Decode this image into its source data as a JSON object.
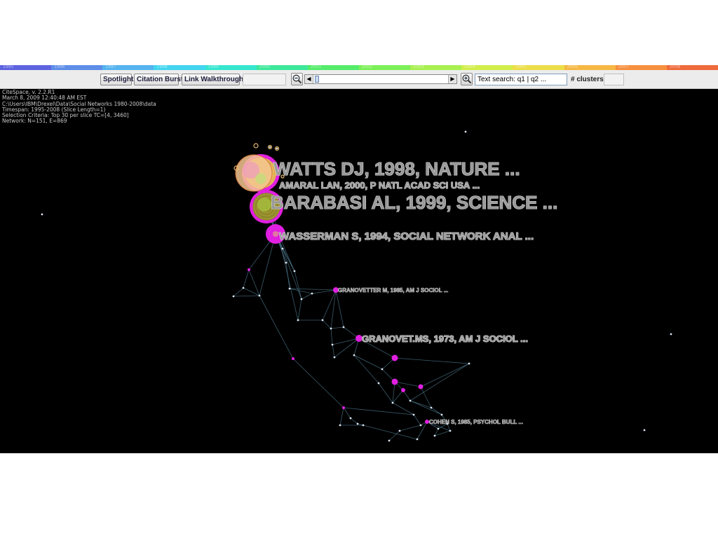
{
  "timeline": {
    "years": [
      "1995",
      "1996",
      "1997",
      "1998",
      "1999",
      "2000",
      "2001",
      "2002",
      "2003",
      "2004",
      "2005",
      "2006",
      "2007",
      "2008"
    ],
    "colors": [
      "#5e64e0",
      "#5e8ee8",
      "#55b3ee",
      "#43d5f0",
      "#36e6cf",
      "#3ee89a",
      "#54ec6a",
      "#7cf058",
      "#a8f050",
      "#d2ee4c",
      "#ecde48",
      "#f6b844",
      "#f69040",
      "#ef6a3c"
    ]
  },
  "toolbar": {
    "spotlight_label": "Spotlight",
    "citation_burst_label": "Citation Burst",
    "link_walkthrough_label": "Link Walkthrough",
    "search_value": "Text search: q1 | q2 ...",
    "clusters_label": "# clusters"
  },
  "info": {
    "version": "CiteSpace, v. 2.2.R1",
    "date": "March 8, 2009 12:40:48 AM EST",
    "path": "C:\\Users\\IBM\\Drexel\\Data\\Social Networks 1980-2008\\data",
    "timespan": "Timespan: 1995-2008 (Slice Length=1)",
    "criteria": "Selection Criteria: Top 30 per slice TC=[4, 3460]",
    "network": "Network: N=151, E=869"
  },
  "labels": [
    {
      "text": "WATTS DJ,  1998,  NATURE ...",
      "size": "xl"
    },
    {
      "text": "AMARAL LAN,  2000,  P NATL ACAD SCI USA ...",
      "size": "m"
    },
    {
      "text": "BARABASI AL,  1999,  SCIENCE ...",
      "size": "xl"
    },
    {
      "text": "WASSERMAN S,  1994,  SOCIAL NETWORK ANAL ...",
      "size": "l"
    },
    {
      "text": "GRANOVETTER M,  1985,  AM J SOCIOL ...",
      "size": "xs"
    },
    {
      "text": "GRANOVET.MS,  1973,  AM J SOCIOL ...",
      "size": "l"
    },
    {
      "text": "COHEN S,  1985,  PSYCHOL BULL ...",
      "size": "xs"
    }
  ],
  "colors": {
    "background": "#000000",
    "burst_node": "#e01fe0",
    "node": "#dde6f2",
    "edge": "#4e7a8e",
    "label_fill": "#9a9a9a",
    "label_outline": "#dcdcdc"
  }
}
